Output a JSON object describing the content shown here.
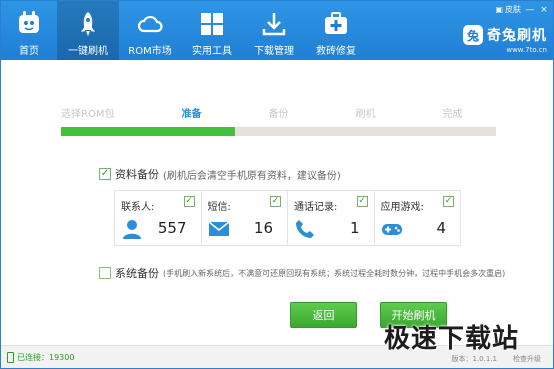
{
  "nav": [
    {
      "label": "首页",
      "icon": "home-icon"
    },
    {
      "label": "一键刷机",
      "icon": "rocket-icon",
      "active": true
    },
    {
      "label": "ROM市场",
      "icon": "cloud-icon"
    },
    {
      "label": "实用工具",
      "icon": "grid-icon"
    },
    {
      "label": "下载管理",
      "icon": "download-icon"
    },
    {
      "label": "救砖修复",
      "icon": "medkit-icon"
    }
  ],
  "window": {
    "skin_label": "皮肤",
    "minimize": "—",
    "close": "×"
  },
  "brand": {
    "name": "奇兔刷机",
    "url": "www.7to.cn",
    "logo_char": "兔"
  },
  "steps": {
    "labels": [
      "选择ROM包",
      "准备",
      "备份",
      "刷机",
      "完成"
    ],
    "active_index": 1,
    "progress": 0.4
  },
  "backup": {
    "checked": true,
    "title": "资料备份",
    "note": "(刷机后会清空手机原有资料，建议备份)",
    "items": [
      {
        "label": "联系人:",
        "value": "557",
        "icon": "contact-icon",
        "checked": true
      },
      {
        "label": "短信:",
        "value": "16",
        "icon": "sms-icon",
        "checked": true
      },
      {
        "label": "通话记录:",
        "value": "1",
        "icon": "call-icon",
        "checked": true
      },
      {
        "label": "应用游戏:",
        "value": "4",
        "icon": "gamepad-icon",
        "checked": true
      }
    ]
  },
  "system_backup": {
    "checked": false,
    "title": "系统备份",
    "note": "(手机刷入新系统后，不满意可还原回现有系统；系统过程全耗时数分钟，过程中手机会多次重启)"
  },
  "buttons": {
    "back": "返回",
    "start": "开始刷机"
  },
  "status": {
    "connected": "已连接：19300",
    "version": "版本：1.0.1.1",
    "check_update": "检查升级"
  },
  "watermark": "极速下载站",
  "colors": {
    "header": "#2585d9",
    "accent": "#2a8fd8",
    "progress": "#44c13a",
    "button": "#46b53a"
  }
}
